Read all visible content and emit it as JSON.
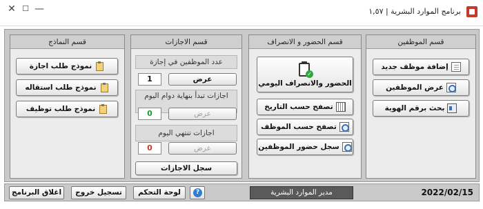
{
  "window": {
    "title": "برنامج الموارد البشرية | ١,٥٧",
    "controls": {
      "minimize": "—",
      "maximize": "☐",
      "close": "✕"
    }
  },
  "panels": {
    "employees": {
      "title": "قسم الموظفين",
      "buttons": [
        {
          "label": "إضافة موظف جديد",
          "icon": "add-employee-icon"
        },
        {
          "label": "عرض الموظفين",
          "icon": "search-icon"
        },
        {
          "label": "بحث برقم الهوية",
          "icon": "id-card-icon"
        }
      ]
    },
    "attendance": {
      "title": "قسم الحضور و الانصراف",
      "main_button": "الحضور والانصراف اليومي",
      "buttons": [
        {
          "label": "تصفح حسب التاريخ",
          "icon": "calendar-icon"
        },
        {
          "label": "تصفح حسب الموظف",
          "icon": "search-icon"
        },
        {
          "label": "سجل حضور الموظفين",
          "icon": "report-icon"
        }
      ]
    },
    "leaves": {
      "title": "قسم الاجازات",
      "on_leave_label": "عدد الموظفين في إجازة",
      "on_leave_count": "1",
      "on_leave_button": "عرض",
      "starting_label": "اجازات تبدأ بنهاية دوام اليوم",
      "starting_count": "0",
      "starting_button": "عرض",
      "ending_label": "اجازات تنتهي اليوم",
      "ending_count": "0",
      "ending_button": "عرض",
      "log_button": "سجل الاجازات",
      "colors": {
        "count_one": "#111111",
        "count_zero_green": "#1a9c2a",
        "count_zero_red": "#c0392b"
      }
    },
    "forms": {
      "title": "قسم النماذج",
      "buttons": [
        {
          "label": "نموذج طلب اجازة",
          "icon": "clipboard-icon"
        },
        {
          "label": "نموذج طلب استقاله",
          "icon": "clipboard-icon"
        },
        {
          "label": "نموذج طلب توظيف",
          "icon": "clipboard-icon"
        }
      ]
    }
  },
  "bottom": {
    "exit_button": "اغلاق البرنامج",
    "logout_button": "تسجيل خروج",
    "dashboard_button": "لوحة التحكم",
    "help_symbol": "?",
    "user_label": "مدير الموارد البشرية",
    "date": "2022/02/15"
  }
}
